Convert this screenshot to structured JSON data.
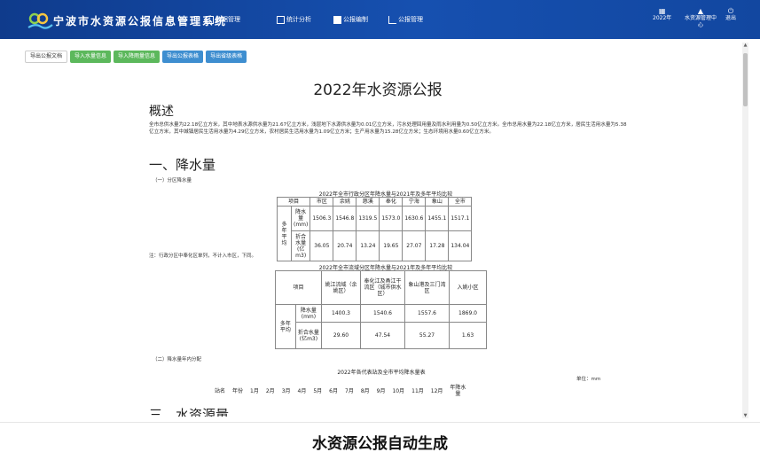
{
  "header": {
    "app_title": "宁波市水资源公报信息管理系统",
    "nav": [
      {
        "label": "数据管理",
        "icon": "database-icon"
      },
      {
        "label": "统计分析",
        "icon": "chart-icon"
      },
      {
        "label": "公报编制",
        "icon": "document-icon"
      },
      {
        "label": "公报管理",
        "icon": "bar-chart-icon"
      }
    ],
    "year_label": "2022年",
    "user_label": "水资源管理中心",
    "logout_label": "退出"
  },
  "toolbar": {
    "buttons": [
      "导出公报文档",
      "导入水量信息",
      "导入降雨量信息",
      "导出公报表格",
      "导出省级表格"
    ]
  },
  "document": {
    "title": "2022年水资源公报",
    "sections": {
      "overview_heading": "概述",
      "overview_text": "全市总供水量为22.18亿立方米，其中地表水源供水量为21.67亿立方米，浅层地下水源供水量为0.01亿立方米，污水处理回用量及雨水利用量为0.50亿立方米。全市总用水量为22.18亿立方米，居民生活用水量为5.38亿立方米，其中城镇居民生活用水量为4.29亿立方米，农村居民生活用水量为1.09亿立方米；生产用水量为15.28亿立方米；生态环境用水量0.60亿立方米。",
      "rain_heading": "一、降水量",
      "rain_sub1": "（一）分区降水量",
      "rain_sub2": "（二）降水量年内分配",
      "water_heading": "三、水资源量"
    },
    "table1": {
      "caption": "2022年全市行政分区年降水量与2021年及多年平均比较",
      "head": [
        "项目",
        "市区",
        "余姚",
        "慈溪",
        "奉化",
        "宁海",
        "象山",
        "全市"
      ],
      "group_label": "多年平均",
      "rows": [
        {
          "label": "降水量(mm)",
          "values": [
            "1506.3",
            "1546.8",
            "1319.5",
            "1573.0",
            "1630.6",
            "1455.1",
            "1517.1"
          ]
        },
        {
          "label": "折合水量(亿m3)",
          "values": [
            "36.05",
            "20.74",
            "13.24",
            "19.65",
            "27.07",
            "17.28",
            "134.04"
          ]
        }
      ],
      "note": "注：行政分区中奉化区单列，不计入市区，下同。"
    },
    "table2": {
      "caption": "2022年全市流域分区年降水量与2021年及多年平均比较",
      "head": [
        "项目",
        "姚江流域（余姚区）",
        "奉化江及甬江干流区（城市供水区）",
        "象山港及三门湾区",
        "入姚小区"
      ],
      "group_label": "多年平均",
      "rows": [
        {
          "label": "降水量(mm)",
          "values": [
            "1400.3",
            "1540.6",
            "1557.6",
            "1869.0"
          ]
        },
        {
          "label": "折合水量(亿m3)",
          "values": [
            "29.60",
            "47.54",
            "55.27",
            "1.63"
          ]
        }
      ]
    },
    "table3": {
      "caption": "2022年各代表站及全市平均降水量表",
      "unit": "单位：mm",
      "head": [
        "站名",
        "年份",
        "1月",
        "2月",
        "3月",
        "4月",
        "5月",
        "6月",
        "7月",
        "8月",
        "9月",
        "10月",
        "11月",
        "12月",
        "年降水量"
      ]
    }
  },
  "footer_caption": "水资源公报自动生成",
  "colors": {
    "header_bg": "#1650b0",
    "btn_green": "#5cb85c",
    "btn_blue": "#3e8ed0"
  }
}
